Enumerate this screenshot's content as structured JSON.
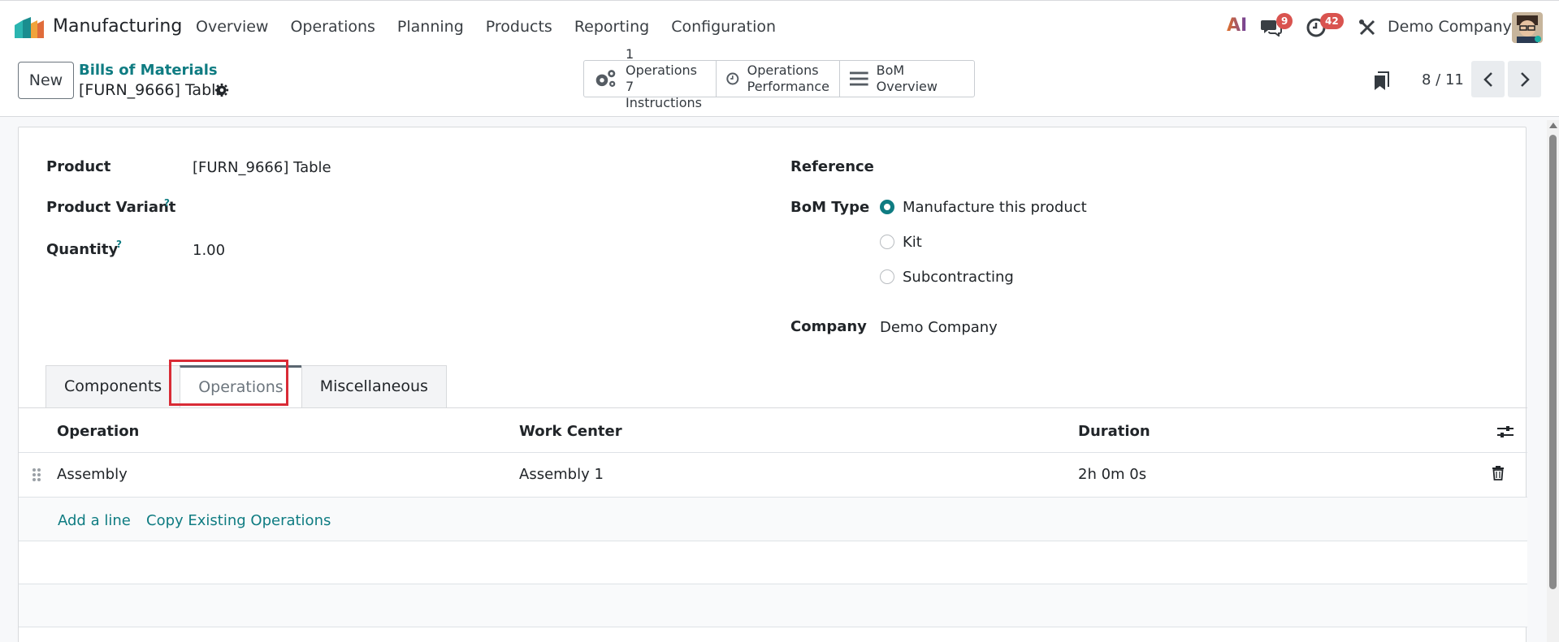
{
  "navbar": {
    "app_name": "Manufacturing",
    "menu": [
      "Overview",
      "Operations",
      "Planning",
      "Products",
      "Reporting",
      "Configuration"
    ],
    "ai_label": "AI",
    "chat_badge": "9",
    "activity_badge": "42",
    "company": "Demo Company"
  },
  "control": {
    "new_label": "New",
    "breadcrumb": "Bills of Materials",
    "record_title": "[FURN_9666] Table",
    "smart_buttons": {
      "ops_line1": "1 Operations",
      "ops_line2": "7 Instructions",
      "perf_line1": "Operations",
      "perf_line2": "Performance",
      "overview": "BoM Overview"
    },
    "pager": "8 / 11"
  },
  "form": {
    "product_label": "Product",
    "product_value": "[FURN_9666] Table",
    "variant_label": "Product Variant",
    "quantity_label": "Quantity",
    "quantity_value": "1.00",
    "help_mark": "?",
    "reference_label": "Reference",
    "bom_type_label": "BoM Type",
    "bom_types": [
      "Manufacture this product",
      "Kit",
      "Subcontracting"
    ],
    "company_label": "Company",
    "company_value": "Demo Company"
  },
  "tabs": [
    "Components",
    "Operations",
    "Miscellaneous"
  ],
  "table": {
    "headers": [
      "Operation",
      "Work Center",
      "Duration"
    ],
    "rows": [
      {
        "operation": "Assembly",
        "work_center": "Assembly 1",
        "duration": "2h 0m 0s"
      }
    ],
    "add_line": "Add a line",
    "copy_existing": "Copy Existing Operations"
  },
  "colors": {
    "accent": "#0f7c82",
    "highlight": "#d92b36",
    "badge": "#d9534f"
  }
}
